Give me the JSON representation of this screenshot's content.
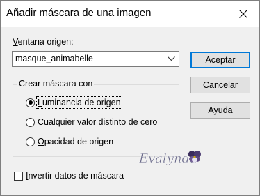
{
  "dialog": {
    "title": "Añadir máscara de una imagen",
    "source_label_first": "V",
    "source_label_rest": "entana origen:",
    "source_value": "masque_animabelle",
    "buttons": {
      "ok": "Aceptar",
      "cancel": "Cancelar",
      "help": "Ayuda"
    },
    "group": {
      "legend": "Crear máscara con",
      "options": [
        {
          "key": "L",
          "rest": "uminancia de origen",
          "checked": true
        },
        {
          "key": "C",
          "rest": "ualquier valor distinto de cero",
          "checked": false
        },
        {
          "key": "O",
          "rest": "pacidad de origen",
          "checked": false
        }
      ]
    },
    "invert": {
      "key": "I",
      "rest": "nvertir datos de máscara",
      "checked": false
    },
    "watermark_text": "Evalynda"
  }
}
